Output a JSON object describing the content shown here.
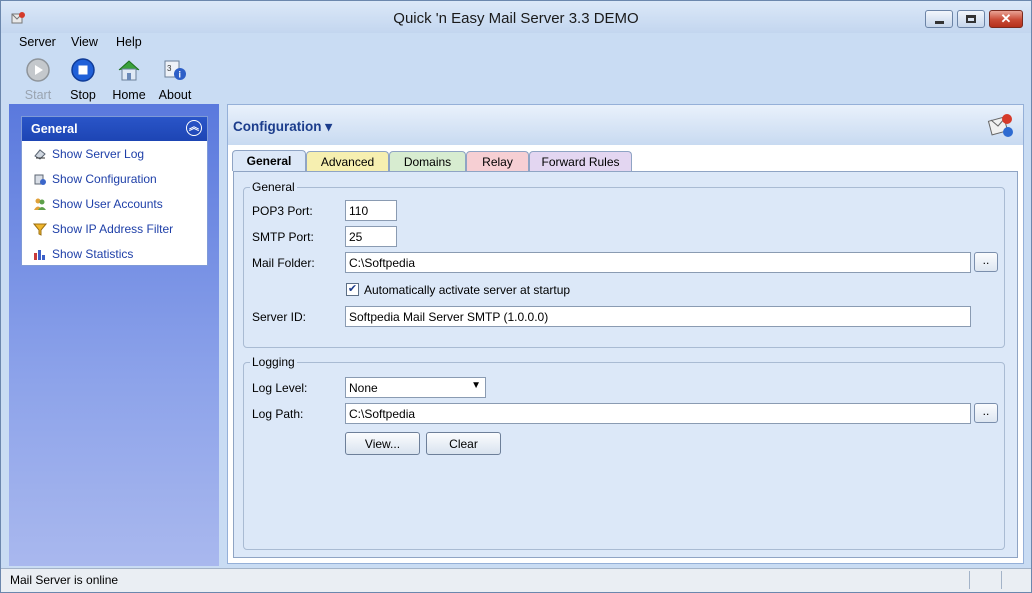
{
  "window": {
    "title": "Quick 'n Easy Mail Server 3.3 DEMO"
  },
  "menu": [
    "Server",
    "View",
    "Help"
  ],
  "toolbar": {
    "start": "Start",
    "stop": "Stop",
    "home": "Home",
    "about": "About"
  },
  "sidebar": {
    "header": "General",
    "items": [
      "Show Server Log",
      "Show Configuration",
      "Show User Accounts",
      "Show IP Address Filter",
      "Show Statistics"
    ]
  },
  "config": {
    "title": "Configuration ▾",
    "tabs": [
      "General",
      "Advanced",
      "Domains",
      "Relay",
      "Forward Rules"
    ],
    "general_group": "General",
    "pop3_label": "POP3 Port:",
    "pop3_value": "110",
    "smtp_label": "SMTP Port:",
    "smtp_value": "25",
    "mail_folder_label": "Mail Folder:",
    "mail_folder_value": "C:\\Softpedia",
    "browse_label": "..",
    "autostart_label": "Automatically activate server at startup",
    "autostart_checked": true,
    "server_id_label": "Server ID:",
    "server_id_value": "Softpedia Mail Server SMTP (1.0.0.0)",
    "logging_group": "Logging",
    "log_level_label": "Log Level:",
    "log_level_value": "None",
    "log_path_label": "Log Path:",
    "log_path_value": "C:\\Softpedia",
    "view_button": "View...",
    "clear_button": "Clear"
  },
  "status": {
    "text": "Mail Server is online"
  },
  "colors": {
    "sidebar_header": "#1d45b4",
    "link": "#1e3fa8",
    "tab_advanced": "#f6efb0",
    "tab_domains": "#d7ecd0",
    "tab_relay": "#f6cfd3",
    "tab_forward": "#e3d6f1"
  }
}
